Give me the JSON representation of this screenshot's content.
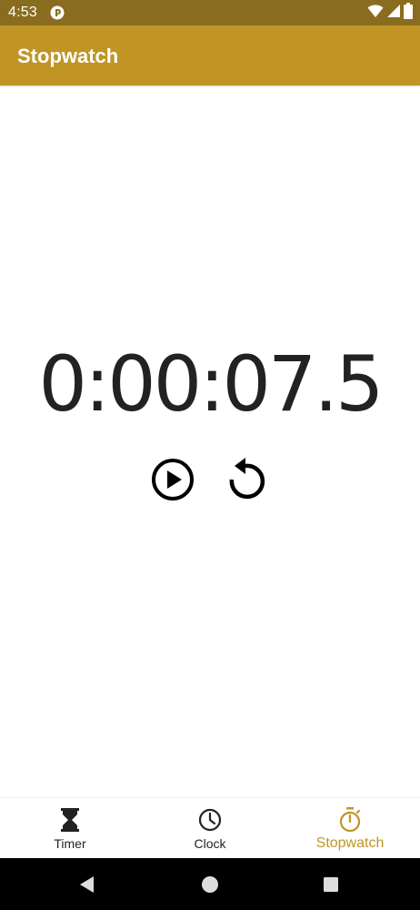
{
  "status_bar": {
    "time": "4:53"
  },
  "app_bar": {
    "title": "Stopwatch"
  },
  "stopwatch": {
    "elapsed": "0:00:07.5"
  },
  "bottom_nav": {
    "items": [
      {
        "label": "Timer",
        "icon": "hourglass-icon",
        "active": false
      },
      {
        "label": "Clock",
        "icon": "clock-icon",
        "active": false
      },
      {
        "label": "Stopwatch",
        "icon": "stopwatch-icon",
        "active": true
      }
    ]
  },
  "colors": {
    "status_bar": "#8a6c1e",
    "app_bar": "#c09525",
    "accent": "#c09525",
    "text_dark": "#222222",
    "system_nav": "#000000"
  }
}
